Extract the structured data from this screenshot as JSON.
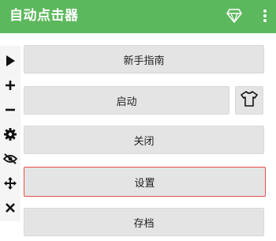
{
  "app": {
    "title": "自动点击器",
    "colors": {
      "appbar": "#5cb85c",
      "button_bg": "#e4e4e4",
      "focus_border": "#e84c4c"
    }
  },
  "appbar_icons": [
    "diamond-icon",
    "more-vert-icon"
  ],
  "toolbar": {
    "tools": [
      "play-icon",
      "plus-icon",
      "minus-icon",
      "gear-icon",
      "eye-off-icon",
      "move-icon",
      "close-icon"
    ]
  },
  "menu": {
    "guide_label": "新手指南",
    "start_label": "启动",
    "close_label": "关闭",
    "settings_label": "设置",
    "save_label": "存档"
  },
  "focused_item": "设置"
}
